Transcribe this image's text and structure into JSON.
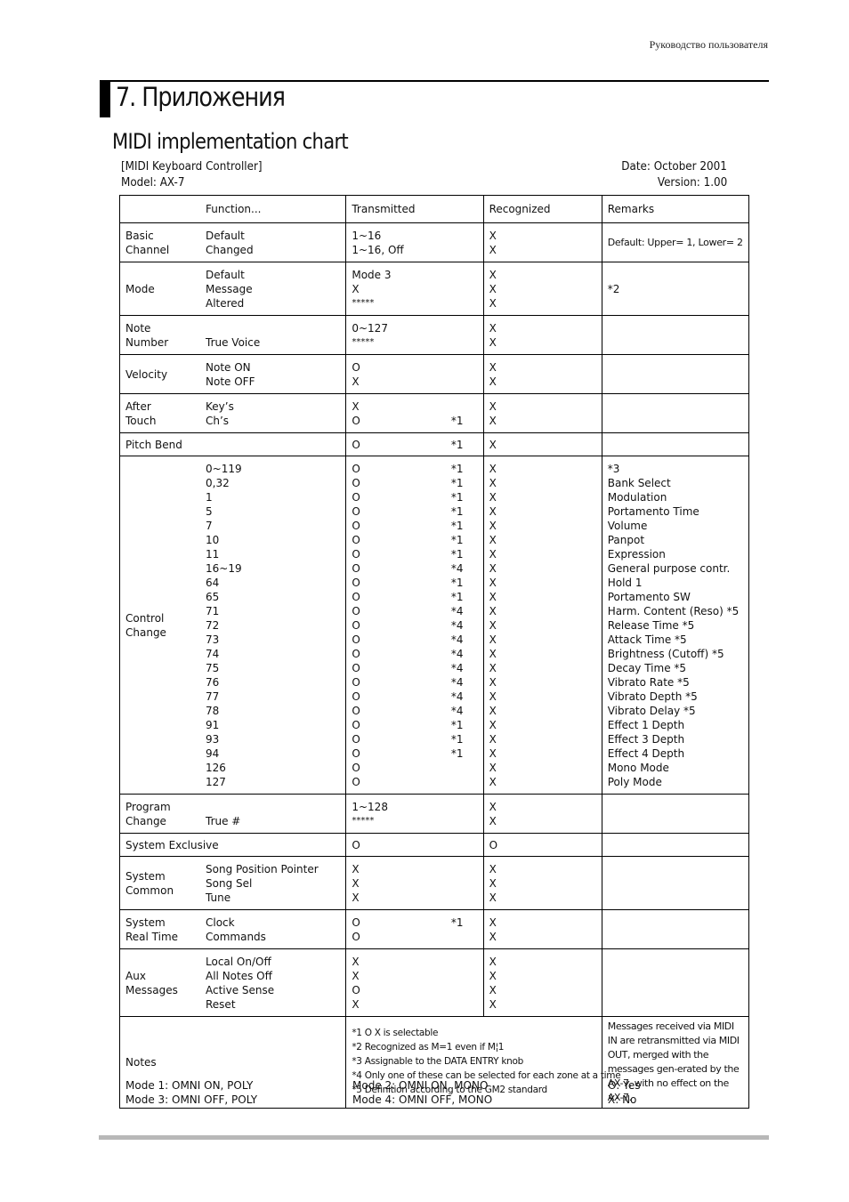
{
  "header": {
    "running_title": "Руководство пользователя",
    "chapter_title": "7. Приложения",
    "section_title": "MIDI implementation chart",
    "device_type": "[MIDI Keyboard Controller]",
    "model": "Model: AX-7",
    "date": "Date: October 2001",
    "version": "Version: 1.00"
  },
  "table": {
    "columns": [
      "Function...",
      "Transmitted",
      "Recognized",
      "Remarks"
    ],
    "rows": [
      {
        "group": [
          "Basic",
          "Channel"
        ],
        "functions": [
          "Default",
          "Changed"
        ],
        "transmitted": [
          {
            "v": "1~16",
            "n": ""
          },
          {
            "v": "1~16, Off",
            "n": ""
          }
        ],
        "recognized": [
          "X",
          "X"
        ],
        "remarks": [
          "Default: Upper= 1, Lower= 2"
        ]
      },
      {
        "group": [
          "Mode"
        ],
        "functions": [
          "Default",
          "Message",
          "Altered"
        ],
        "transmitted": [
          {
            "v": "Mode 3",
            "n": ""
          },
          {
            "v": "X",
            "n": ""
          },
          {
            "v": "*****",
            "n": ""
          }
        ],
        "recognized": [
          "X",
          "X",
          "X"
        ],
        "remarks": [
          "*2"
        ]
      },
      {
        "group": [
          "Note",
          "Number"
        ],
        "functions": [
          "",
          "True Voice"
        ],
        "transmitted": [
          {
            "v": "0~127",
            "n": ""
          },
          {
            "v": "*****",
            "n": ""
          }
        ],
        "recognized": [
          "X",
          "X"
        ],
        "remarks": []
      },
      {
        "group": [
          "Velocity"
        ],
        "functions": [
          "Note ON",
          "Note OFF"
        ],
        "transmitted": [
          {
            "v": "O",
            "n": ""
          },
          {
            "v": "X",
            "n": ""
          }
        ],
        "recognized": [
          "X",
          "X"
        ],
        "remarks": []
      },
      {
        "group": [
          "After",
          "Touch"
        ],
        "functions": [
          "Key’s",
          "Ch’s"
        ],
        "transmitted": [
          {
            "v": "X",
            "n": ""
          },
          {
            "v": "O",
            "n": "*1"
          }
        ],
        "recognized": [
          "X",
          "X"
        ],
        "remarks": []
      },
      {
        "group": [
          "Pitch Bend"
        ],
        "functions": [],
        "transmitted": [
          {
            "v": "O",
            "n": "*1"
          }
        ],
        "recognized": [
          "X"
        ],
        "remarks": []
      },
      {
        "group": [
          "Control",
          "Change"
        ],
        "functions": [
          "0~119",
          "0,32",
          "1",
          "5",
          "7",
          "10",
          "11",
          "16~19",
          "64",
          "65",
          "71",
          "72",
          "73",
          "74",
          "75",
          "76",
          "77",
          "78",
          "91",
          "93",
          "94",
          "126",
          "127"
        ],
        "transmitted": [
          {
            "v": "O",
            "n": "*1"
          },
          {
            "v": "O",
            "n": "*1"
          },
          {
            "v": "O",
            "n": "*1"
          },
          {
            "v": "O",
            "n": "*1"
          },
          {
            "v": "O",
            "n": "*1"
          },
          {
            "v": "O",
            "n": "*1"
          },
          {
            "v": "O",
            "n": "*1"
          },
          {
            "v": "O",
            "n": "*4"
          },
          {
            "v": "O",
            "n": "*1"
          },
          {
            "v": "O",
            "n": "*1"
          },
          {
            "v": "O",
            "n": "*4"
          },
          {
            "v": "O",
            "n": "*4"
          },
          {
            "v": "O",
            "n": "*4"
          },
          {
            "v": "O",
            "n": "*4"
          },
          {
            "v": "O",
            "n": "*4"
          },
          {
            "v": "O",
            "n": "*4"
          },
          {
            "v": "O",
            "n": "*4"
          },
          {
            "v": "O",
            "n": "*4"
          },
          {
            "v": "O",
            "n": "*1"
          },
          {
            "v": "O",
            "n": "*1"
          },
          {
            "v": "O",
            "n": "*1"
          },
          {
            "v": "O",
            "n": ""
          },
          {
            "v": "O",
            "n": ""
          }
        ],
        "recognized": [
          "X",
          "X",
          "X",
          "X",
          "X",
          "X",
          "X",
          "X",
          "X",
          "X",
          "X",
          "X",
          "X",
          "X",
          "X",
          "X",
          "X",
          "X",
          "X",
          "X",
          "X",
          "X",
          "X"
        ],
        "remarks": [
          "*3",
          "Bank Select",
          "Modulation",
          "Portamento Time",
          "Volume",
          "Panpot",
          "Expression",
          "General purpose contr.",
          "Hold 1",
          "Portamento SW",
          "Harm. Content (Reso) *5",
          "Release Time *5",
          "Attack Time *5",
          "Brightness (Cutoff) *5",
          "Decay Time *5",
          "Vibrato Rate *5",
          "Vibrato Depth *5",
          "Vibrato Delay *5",
          "Effect 1 Depth",
          "Effect 3 Depth",
          "Effect 4 Depth",
          "Mono Mode",
          "Poly Mode"
        ]
      },
      {
        "group": [
          "Program",
          "Change"
        ],
        "functions": [
          "",
          "True #"
        ],
        "transmitted": [
          {
            "v": "1~128",
            "n": ""
          },
          {
            "v": "*****",
            "n": ""
          }
        ],
        "recognized": [
          "X",
          "X"
        ],
        "remarks": []
      },
      {
        "group": [
          "System Exclusive"
        ],
        "functions": [],
        "transmitted": [
          {
            "v": "O",
            "n": ""
          }
        ],
        "recognized": [
          "O"
        ],
        "remarks": []
      },
      {
        "group": [
          "System",
          "Common"
        ],
        "functions": [
          "Song Position Pointer",
          "Song Sel",
          "Tune"
        ],
        "transmitted": [
          {
            "v": "X",
            "n": ""
          },
          {
            "v": "X",
            "n": ""
          },
          {
            "v": "X",
            "n": ""
          }
        ],
        "recognized": [
          "X",
          "X",
          "X"
        ],
        "remarks": []
      },
      {
        "group": [
          "System",
          "Real Time"
        ],
        "functions": [
          "Clock",
          "Commands"
        ],
        "transmitted": [
          {
            "v": "O",
            "n": "*1"
          },
          {
            "v": "O",
            "n": ""
          }
        ],
        "recognized": [
          "X",
          "X"
        ],
        "remarks": []
      },
      {
        "group": [
          "Aux",
          "Messages"
        ],
        "functions": [
          "Local On/Off",
          "All Notes Off",
          "Active Sense",
          "Reset"
        ],
        "transmitted": [
          {
            "v": "X",
            "n": ""
          },
          {
            "v": "X",
            "n": ""
          },
          {
            "v": "O",
            "n": ""
          },
          {
            "v": "X",
            "n": ""
          }
        ],
        "recognized": [
          "X",
          "X",
          "X",
          "X"
        ],
        "remarks": []
      }
    ],
    "notes": {
      "label": "Notes",
      "items": [
        "*1 O X is selectable",
        "*2 Recognized as M=1 even if M¦1",
        "*3 Assignable to the DATA ENTRY knob",
        "*4 Only one of these can be selected for each zone at a time",
        "*5 Definition according to the GM2 standard"
      ],
      "remark": "Messages received via MIDI IN are retransmitted via MIDI OUT, merged with the messages gen-erated by the AX-7, with no effect on the AX-7."
    }
  },
  "legend": {
    "col1": [
      "Mode 1: OMNI ON, POLY",
      "Mode 3: OMNI OFF, POLY"
    ],
    "col2": [
      "Mode 2: OMNI ON, MONO",
      "Mode 4: OMNI OFF, MONO"
    ],
    "col3": [
      "O: Yes",
      "X: No"
    ]
  }
}
